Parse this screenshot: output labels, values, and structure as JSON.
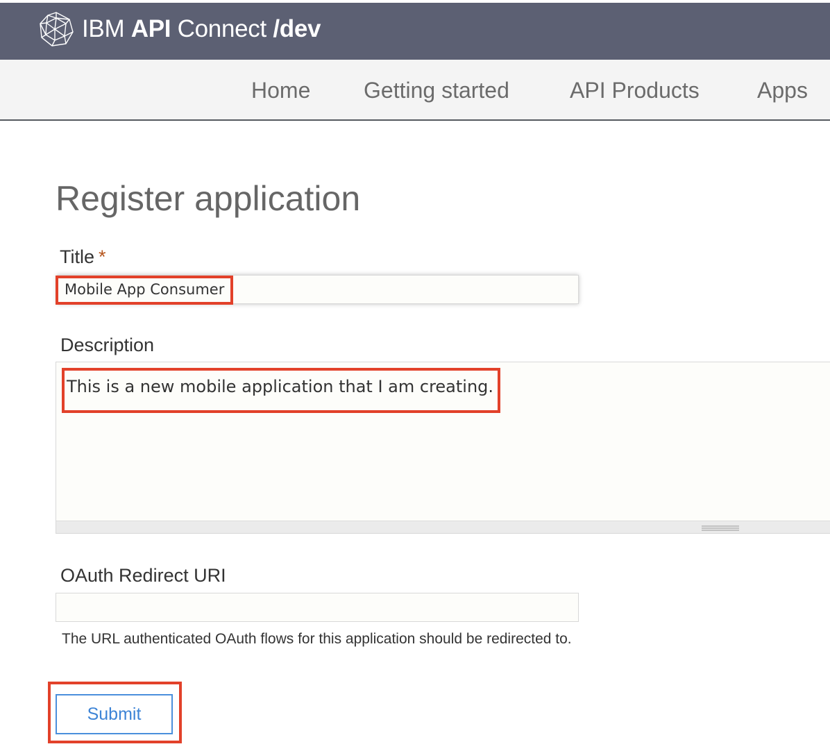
{
  "header": {
    "brand_ibm": "IBM",
    "brand_api": "API",
    "brand_connect": "Connect",
    "brand_path": "/dev",
    "logo_icon": "geodesic-sphere-icon"
  },
  "nav": {
    "items": [
      {
        "label": "Home"
      },
      {
        "label": "Getting started"
      },
      {
        "label": "API Products"
      },
      {
        "label": "Apps"
      }
    ]
  },
  "main": {
    "page_title": "Register application",
    "title_field": {
      "label": "Title",
      "required_marker": "*",
      "value": "Mobile App Consumer"
    },
    "description_field": {
      "label": "Description",
      "value": "This is a new mobile application that I am creating."
    },
    "oauth_field": {
      "label": "OAuth Redirect URI",
      "value": "",
      "help_text": "The URL authenticated OAuth flows for this application should be redirected to."
    },
    "submit_label": "Submit"
  },
  "colors": {
    "header_bg": "#5c6073",
    "nav_bg": "#f4f4f4",
    "required_star": "#b5551c",
    "submit_accent": "#4a8fdc",
    "annotation_red": "#e2412a"
  }
}
